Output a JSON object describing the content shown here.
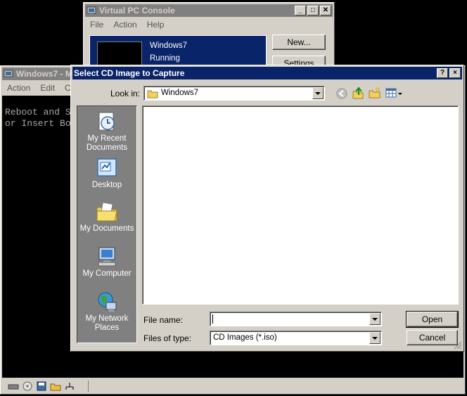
{
  "console": {
    "title": "Virtual PC Console",
    "menu": [
      "File",
      "Action",
      "Help"
    ],
    "vm_name": "Windows7",
    "vm_status": "Running",
    "new_button": "New...",
    "settings_button": "Settings"
  },
  "vm_window": {
    "title": "Windows7 - M",
    "menu": [
      "Action",
      "Edit",
      "CD"
    ],
    "screen_lines": [
      "Reboot and S",
      "or Insert Bo"
    ]
  },
  "dialog": {
    "title": "Select CD Image to Capture",
    "help_button": "?",
    "close_button": "×",
    "look_in_label": "Look in:",
    "look_in_value": "Windows7",
    "places": [
      {
        "label": "My Recent Documents",
        "icon": "recent-documents-icon"
      },
      {
        "label": "Desktop",
        "icon": "desktop-icon"
      },
      {
        "label": "My Documents",
        "icon": "my-documents-icon"
      },
      {
        "label": "My Computer",
        "icon": "my-computer-icon"
      },
      {
        "label": "My Network Places",
        "icon": "network-places-icon"
      }
    ],
    "file_name_label": "File name:",
    "file_name_value": "",
    "files_of_type_label": "Files of type:",
    "files_of_type_value": "CD Images (*.iso)",
    "open_button": "Open",
    "cancel_button": "Cancel"
  },
  "colors": {
    "active_title": "#0a246a",
    "inactive_title": "#808080",
    "face": "#d4d0c8",
    "places_bg": "#808080"
  }
}
